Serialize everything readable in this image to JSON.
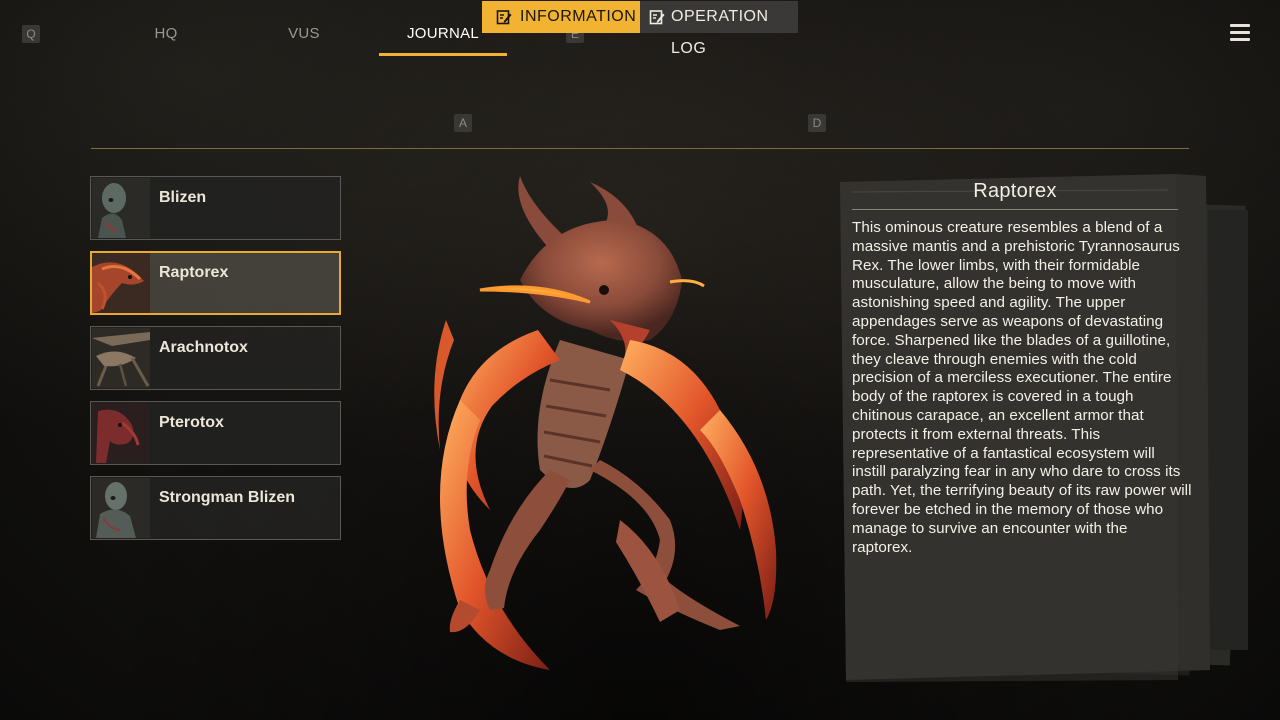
{
  "nav": {
    "left_key": "Q",
    "right_key": "E",
    "tabs": [
      {
        "label": "HQ"
      },
      {
        "label": "VUS"
      },
      {
        "label": "JOURNAL"
      }
    ],
    "menu_icon": "hamburger-menu-icon"
  },
  "subtabs": {
    "left_key": "A",
    "right_key": "D",
    "information": "INFORMATION",
    "operation_log": "OPERATION LOG",
    "icon": "edit-note-icon"
  },
  "creatures": [
    {
      "name": "Blizen"
    },
    {
      "name": "Raptorex"
    },
    {
      "name": "Arachnotox"
    },
    {
      "name": "Pterotox"
    },
    {
      "name": "Strongman Blizen"
    }
  ],
  "selected_creature": "Raptorex",
  "info": {
    "title": "Raptorex",
    "description": "This ominous creature resembles a blend of a massive mantis and a prehistoric Tyrannosaurus Rex. The lower limbs, with their formidable musculature, allow the being to move with astonishing speed and agility. The upper appendages serve as weapons of devastating force. Sharpened like the blades of a guillotine, they cleave through enemies with the cold precision of a merciless executioner. The entire body of the raptorex is covered in a tough chitinous carapace, an excellent armor that protects it from external threats. This representative of a fantastical ecosystem will instill paralyzing fear in any who dare to cross its path. Yet, the terrifying beauty of its raw power will forever be etched in the memory of those who manage to survive an encounter with the raptorex."
  },
  "colors": {
    "accent": "#f2b232",
    "selected_border": "#e8a833",
    "divider": "#7d6a45"
  }
}
